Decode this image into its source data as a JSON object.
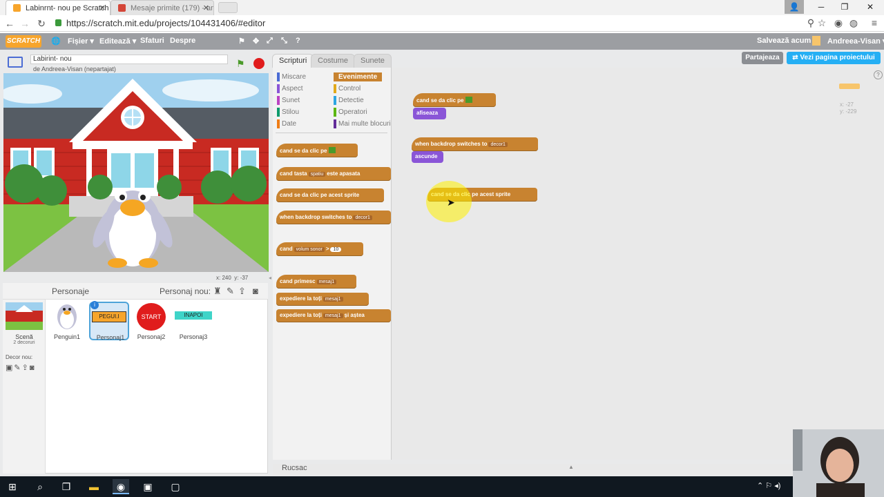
{
  "browser": {
    "tabs": [
      {
        "title": "Labinrnt- nou pe Scratch",
        "favicon_color": "#f7a52c"
      },
      {
        "title": "Mesaje primite (179) - an",
        "favicon_color": "#d44638"
      }
    ],
    "url": "https://scratch.mit.edu/projects/104431406/#editor"
  },
  "topbar": {
    "logo": "SCRATCH",
    "menus": [
      "Fișier",
      "Editează",
      "Sfaturi",
      "Despre"
    ],
    "save_now": "Salvează acum",
    "user": "Andreea-Visan"
  },
  "project": {
    "title": "Labirint- nou",
    "author": "de Andreea-Visan (nepartajat)",
    "share": "Partajeaza",
    "see_page": "Vezi pagina proiectului",
    "stage_x": "x: 240",
    "stage_y": "y: -37"
  },
  "tabs": [
    "Scripturi",
    "Costume",
    "Sunete"
  ],
  "categories": {
    "left": [
      {
        "label": "Miscare",
        "color": "#4a6cd4"
      },
      {
        "label": "Aspect",
        "color": "#8a55d7"
      },
      {
        "label": "Sunet",
        "color": "#bb42c3"
      },
      {
        "label": "Stilou",
        "color": "#0e9a6c"
      },
      {
        "label": "Date",
        "color": "#ee7d16"
      }
    ],
    "right": [
      {
        "label": "Evenimente",
        "color": "#c88330",
        "active": true
      },
      {
        "label": "Control",
        "color": "#e1a91a"
      },
      {
        "label": "Detectie",
        "color": "#2ca5e2"
      },
      {
        "label": "Operatori",
        "color": "#5cb712"
      },
      {
        "label": "Mai multe blocuri",
        "color": "#632d99"
      }
    ]
  },
  "palette_blocks": {
    "b1": "cand se da clic pe",
    "b2_a": "cand tasta",
    "b2_in": "spatiu",
    "b2_b": "este apasata",
    "b3": "cand se da clic pe acest sprite",
    "b4_a": "when backdrop switches to",
    "b4_in": "decor1",
    "b5_a": "cand",
    "b5_in": "volum sonor",
    "b5_op": ">",
    "b5_val": "10",
    "b6_a": "cand primesc",
    "b6_in": "mesaj1",
    "b7_a": "expediere la toți",
    "b7_in": "mesaj1",
    "b8_a": "expediere la toți",
    "b8_in": "mesaj1",
    "b8_b": "și aștea"
  },
  "script_blocks": {
    "s1": "cand se da clic pe",
    "s1_child": "afiseaza",
    "s2_a": "when backdrop switches to",
    "s2_in": "decor1",
    "s2_child": "ascunde",
    "s3": "cand se da clic pe acest sprite"
  },
  "script_coords": {
    "x": "x: -27",
    "y": "y: -229"
  },
  "sprites_panel": {
    "title": "Personaje",
    "new_sprite": "Personaj nou:",
    "stage_label": "Scenă",
    "stage_sub": "2 decoruri",
    "new_backdrop": "Decor nou:",
    "sprites": [
      {
        "name": "Penguin1",
        "thumb": "penguin"
      },
      {
        "name": "Personaj1",
        "thumb_text": "PEGUI.I",
        "selected": true
      },
      {
        "name": "Personaj2",
        "thumb_text": "START"
      },
      {
        "name": "Personaj3",
        "thumb_text": "INAPOI"
      }
    ]
  },
  "backpack": "Rucsac"
}
